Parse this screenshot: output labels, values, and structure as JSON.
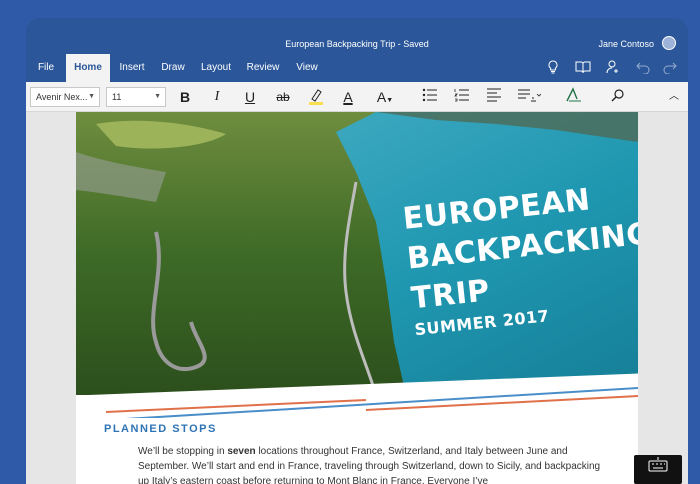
{
  "window": {
    "doc_title": "European Backpacking Trip - Saved",
    "user_name": "Jane Contoso"
  },
  "tabs": [
    "File",
    "Home",
    "Insert",
    "Draw",
    "Layout",
    "Review",
    "View"
  ],
  "toolbar": {
    "font_name": "Avenir Nex...",
    "font_size": "11",
    "bold": "B",
    "italic": "I",
    "underline": "U",
    "strikethrough": "ab",
    "font_color": "A",
    "text_style": "A"
  },
  "hero": {
    "line1": "EUROPEAN",
    "line2": "BACKPACKING",
    "line3": "TRIP",
    "subtitle": "SUMMER 2017"
  },
  "document": {
    "section_heading": "PLANNED STOPS",
    "para_pre": "We’ll be stopping in ",
    "para_bold": "seven",
    "para_post": " locations throughout France, Switzerland, and Italy between June and September. We’ll start and end in France, traveling through Switzerland, down to Sicily, and backpacking up Italy’s eastern coast before returning to Mont Blanc in France. Everyone I’ve"
  },
  "colors": {
    "ribbon_blue": "#2b579a",
    "heading_blue": "#2e74b5",
    "stripe_blue": "#4a8ec9",
    "stripe_orange": "#e0704a"
  },
  "icons": [
    "lightbulb-icon",
    "book-icon",
    "share-person-icon",
    "undo-icon",
    "redo-icon",
    "highlighter-icon",
    "bullets-icon",
    "numbering-icon",
    "align-icon",
    "paragraph-icon",
    "styles-icon",
    "search-icon",
    "collapse-ribbon-icon",
    "keyboard-icon"
  ]
}
